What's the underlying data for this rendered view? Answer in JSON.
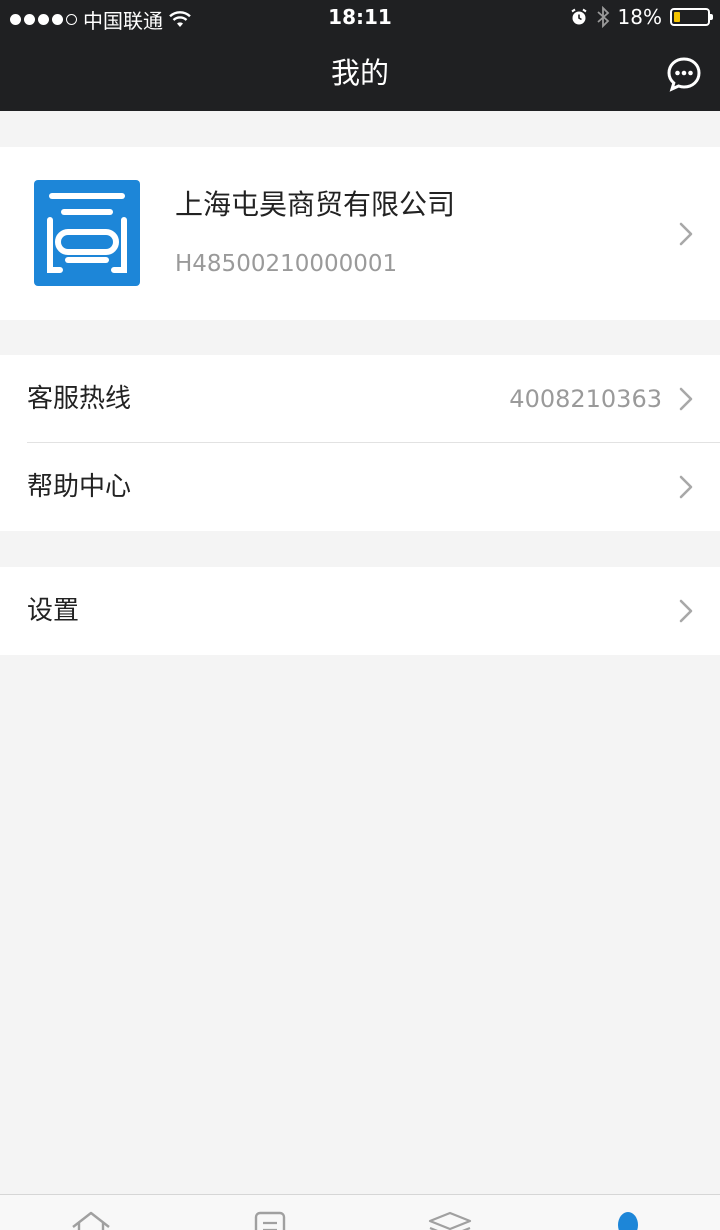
{
  "status_bar": {
    "carrier": "中国联通",
    "time": "18:11",
    "battery": "18%",
    "battery_level": 0.18
  },
  "nav": {
    "title": "我的",
    "right_icon": "chat-bubble-icon"
  },
  "profile": {
    "company_name": "上海屯昊商贸有限公司",
    "company_code": "H48500210000001",
    "logo_icon": "company-logo-icon",
    "logo_color": "#1d86d8"
  },
  "menu": {
    "hotline_label": "客服热线",
    "hotline_value": "4008210363",
    "help_label": "帮助中心",
    "settings_label": "设置"
  },
  "tabs": [
    {
      "icon": "home-icon",
      "active": false
    },
    {
      "icon": "document-icon",
      "active": false
    },
    {
      "icon": "layers-icon",
      "active": false
    },
    {
      "icon": "user-icon",
      "active": true
    }
  ],
  "colors": {
    "topbar": "#1f2022",
    "accent": "#1d86d8",
    "background": "#f4f4f4"
  }
}
